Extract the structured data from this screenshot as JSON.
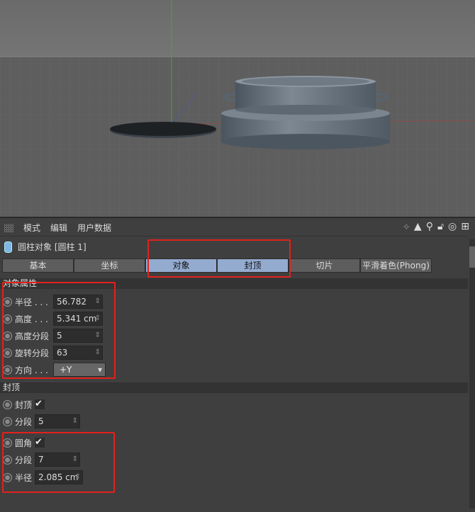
{
  "menu": {
    "items": [
      "模式",
      "编辑",
      "用户数据"
    ]
  },
  "object": {
    "title": "圆柱对象 [圆柱 1]"
  },
  "tabs": [
    {
      "label": "基本",
      "active": false
    },
    {
      "label": "坐标",
      "active": false
    },
    {
      "label": "对象",
      "active": true
    },
    {
      "label": "封顶",
      "active": true
    },
    {
      "label": "切片",
      "active": false
    },
    {
      "label": "平滑着色(Phong)",
      "active": false
    }
  ],
  "object_props": {
    "header": "对象属性",
    "radius": {
      "label": "半径 . . .",
      "value": "56.782 cm"
    },
    "height": {
      "label": "高度 . . .",
      "value": "5.341 cm"
    },
    "height_seg": {
      "label": "高度分段",
      "value": "5"
    },
    "rot_seg": {
      "label": "旋转分段",
      "value": "63"
    },
    "orientation": {
      "label": "方向 . . .",
      "value": "+Y"
    }
  },
  "caps": {
    "header": "封顶",
    "caps": {
      "label": "封顶",
      "checked": true
    },
    "segments": {
      "label": "分段",
      "value": "5"
    },
    "fillet": {
      "label": "圆角",
      "checked": true
    },
    "fillet_seg": {
      "label": "分段",
      "value": "7"
    },
    "fillet_radius": {
      "label": "半径",
      "value": "2.085 cm"
    }
  },
  "colors": {
    "highlight": "#e3211b",
    "active_tab": "#94abd0"
  },
  "icons": [
    "grid-grip-icon",
    "axis-icon",
    "arrow-up-icon",
    "search-icon",
    "lock-icon",
    "target-icon",
    "add-icon",
    "check-icon",
    "cylinder-icon"
  ]
}
